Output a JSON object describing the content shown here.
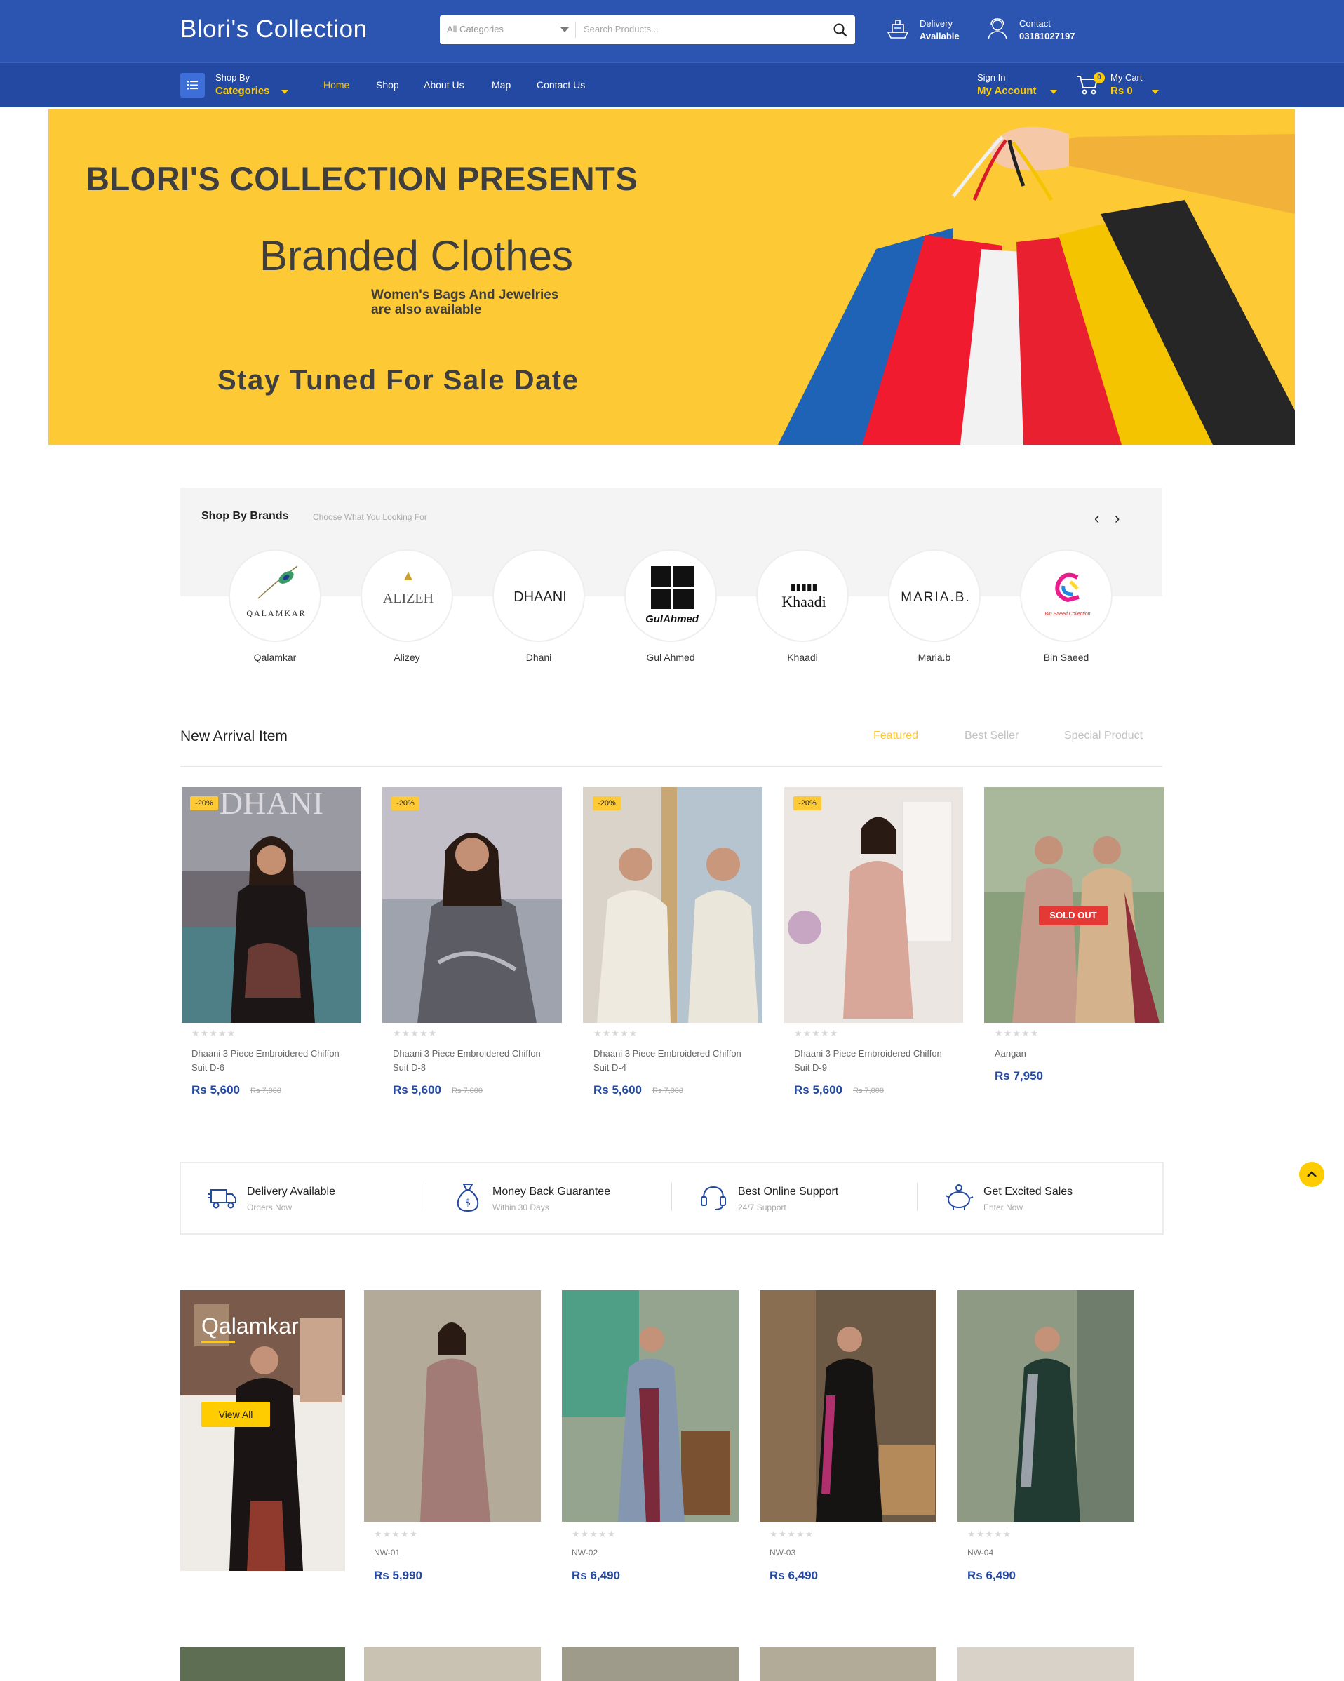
{
  "header": {
    "logo": "Blori's Collection",
    "search": {
      "category": "All Categories",
      "placeholder": "Search Products..."
    },
    "delivery": {
      "line1": "Delivery",
      "line2": "Available"
    },
    "contact": {
      "line1": "Contact",
      "line2": "03181027197"
    }
  },
  "nav": {
    "shop_by": "Shop By",
    "categories": "Categories",
    "links": [
      "Home",
      "Shop",
      "About Us",
      "Map",
      "Contact Us"
    ],
    "sign_in": "Sign In",
    "my_account": "My Account",
    "my_cart": "My Cart",
    "cart_total": "Rs 0",
    "cart_count": "0"
  },
  "hero": {
    "heading": "BLORI'S COLLECTION PRESENTS",
    "title": "Branded Clothes",
    "subtitle": "Women's Bags And Jewelries are also available",
    "cta": "Stay Tuned For Sale Date"
  },
  "brands": {
    "title": "Shop By Brands",
    "subtitle": "Choose What You Looking For",
    "items": [
      {
        "name": "Qalamkar",
        "logo_text": "QALAMKAR"
      },
      {
        "name": "Alizey",
        "logo_text": "ALIZEH"
      },
      {
        "name": "Dhani",
        "logo_text": "DHAANI"
      },
      {
        "name": "Gul Ahmed",
        "logo_text": "GulAhmed"
      },
      {
        "name": "Khaadi",
        "logo_text": "Khaadi"
      },
      {
        "name": "Maria.b",
        "logo_text": "MARIA.B."
      },
      {
        "name": "Bin Saeed",
        "logo_text": "Bin Saeed Collection"
      }
    ]
  },
  "arrivals": {
    "title": "New Arrival Item",
    "tabs": [
      "Featured",
      "Best Seller",
      "Special Product"
    ],
    "products": [
      {
        "badge": "-20%",
        "name": "Dhaani 3 Piece Embroidered Chiffon Suit D-6",
        "price": "Rs 5,600",
        "old": "Rs 7,000",
        "watermark": "DHANI"
      },
      {
        "badge": "-20%",
        "name": "Dhaani 3 Piece Embroidered Chiffon Suit D-8",
        "price": "Rs 5,600",
        "old": "Rs 7,000"
      },
      {
        "badge": "-20%",
        "name": "Dhaani 3 Piece Embroidered Chiffon Suit D-4",
        "price": "Rs 5,600",
        "old": "Rs 7,000"
      },
      {
        "badge": "-20%",
        "name": "Dhaani 3 Piece Embroidered Chiffon Suit D-9",
        "price": "Rs 5,600",
        "old": "Rs 7,000"
      },
      {
        "badge": "SOLD OUT",
        "name": "Aangan",
        "price": "Rs 7,950",
        "old": ""
      }
    ]
  },
  "features": [
    {
      "title": "Delivery Available",
      "sub": "Orders Now",
      "icon": "truck-icon"
    },
    {
      "title": "Money Back Guarantee",
      "sub": "Within 30 Days",
      "icon": "money-bag-icon"
    },
    {
      "title": "Best Online Support",
      "sub": "24/7 Support",
      "icon": "headset-icon"
    },
    {
      "title": "Get Excited Sales",
      "sub": "Enter Now",
      "icon": "piggy-bank-icon"
    }
  ],
  "qalamkar": {
    "title": "Qalamkar",
    "view_all": "View All",
    "products": [
      {
        "code": "NW-01",
        "price": "Rs 5,990"
      },
      {
        "code": "NW-02",
        "price": "Rs 6,490"
      },
      {
        "code": "NW-03",
        "price": "Rs 6,490"
      },
      {
        "code": "NW-04",
        "price": "Rs 6,490"
      }
    ]
  },
  "colors": {
    "primary": "#2b55b0",
    "nav": "#2449a3",
    "accent": "#ffcc00",
    "hero": "#fdc935",
    "sale": "#e53935"
  }
}
